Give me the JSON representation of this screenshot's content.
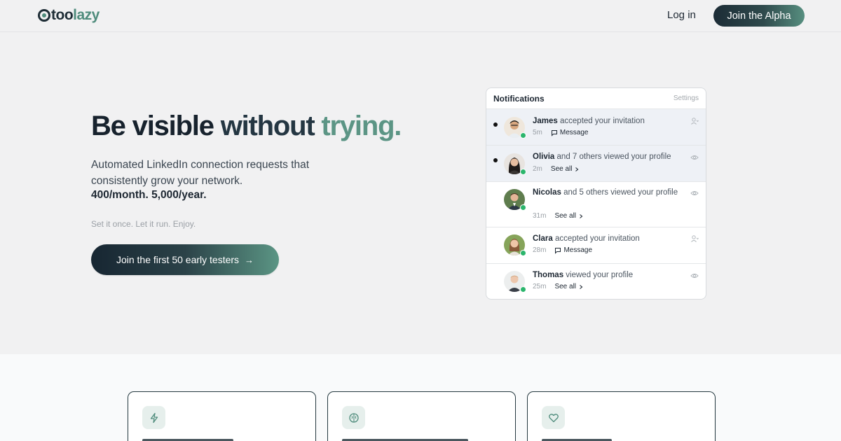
{
  "nav": {
    "logo_text": "too",
    "logo_accent": "lazy",
    "login_label": "Log in",
    "cta_label": "Join the Alpha"
  },
  "hero": {
    "headline_part1": "Be visible",
    "headline_part2": "without",
    "headline_part3": "trying.",
    "subtitle": "Automated LinkedIn connection requests that consistently grow your network.",
    "stats": "400/month. 5,000/year.",
    "tagline": "Set it once. Let it run. Enjoy.",
    "cta_label": "Join the first 50 early testers",
    "cta_arrow": "→"
  },
  "notifications": {
    "title": "Notifications",
    "settings_label": "Settings",
    "items": [
      {
        "name": "James",
        "text": "accepted your invitation",
        "time": "5m",
        "action": "Message",
        "action_icon": "message-icon",
        "unread": true,
        "side_icon": "user-icon"
      },
      {
        "name": "Olivia",
        "text": "and 7 others viewed your profile",
        "time": "2m",
        "action": "See all",
        "action_icon": "chevron-right-icon",
        "unread": true,
        "side_icon": "eye-icon"
      },
      {
        "name": "Nicolas",
        "text": "and 5 others viewed your profile",
        "time": "31m",
        "action": "See all",
        "action_icon": "chevron-right-icon",
        "unread": false,
        "side_icon": "eye-icon"
      },
      {
        "name": "Clara",
        "text": "accepted your invitation",
        "time": "28m",
        "action": "Message",
        "action_icon": "message-icon",
        "unread": false,
        "side_icon": "user-icon"
      },
      {
        "name": "Thomas",
        "text": "viewed your profile",
        "time": "25m",
        "action": "See all",
        "action_icon": "chevron-right-icon",
        "unread": false,
        "side_icon": "eye-icon"
      }
    ]
  },
  "features": {
    "cards": [
      {
        "icon": "lightning-icon"
      },
      {
        "icon": "brain-icon"
      },
      {
        "icon": "heart-icon"
      }
    ]
  },
  "colors": {
    "accent": "#5c9585",
    "dark": "#1c2c36",
    "online": "#2bb56c"
  }
}
